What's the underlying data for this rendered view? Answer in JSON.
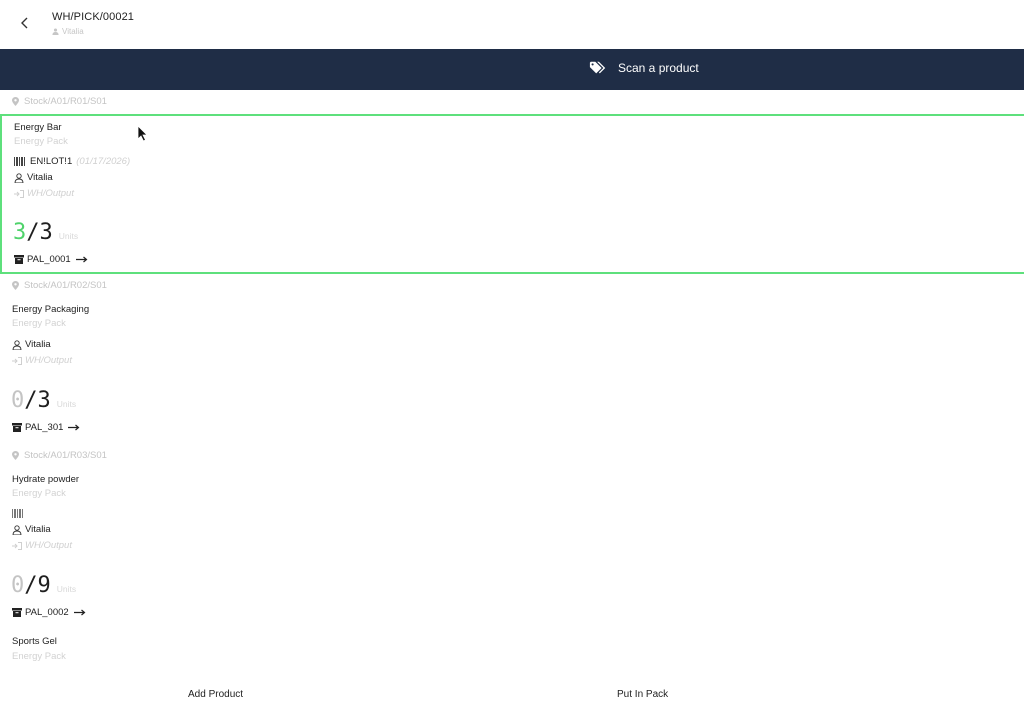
{
  "header": {
    "title": "WH/PICK/00021",
    "user": "Vitalia"
  },
  "scan": {
    "label": "Scan a product"
  },
  "lines": [
    {
      "location": "Stock/A01/R01/S01",
      "product": "Energy Bar",
      "category": "Energy Pack",
      "lot": "EN!LOT!1",
      "lot_date": "(01/17/2026)",
      "owner": "Vitalia",
      "destination": "WH/Output",
      "qty_done": "3",
      "qty_sep": "/",
      "qty_total": "3",
      "unit": "Units",
      "package": "PAL_0001",
      "active": true
    },
    {
      "location": "Stock/A01/R02/S01",
      "product": "Energy Packaging",
      "category": "Energy Pack",
      "owner": "Vitalia",
      "destination": "WH/Output",
      "qty_done": "0",
      "qty_sep": "/",
      "qty_total": "3",
      "unit": "Units",
      "package": "PAL_301",
      "active": false
    },
    {
      "location": "Stock/A01/R03/S01",
      "product": "Hydrate powder",
      "category": "Energy Pack",
      "lot": "",
      "owner": "Vitalia",
      "destination": "WH/Output",
      "qty_done": "0",
      "qty_sep": "/",
      "qty_total": "9",
      "unit": "Units",
      "package": "PAL_0002",
      "active": false
    },
    {
      "product": "Sports Gel",
      "category": "Energy Pack"
    }
  ],
  "footer": {
    "add_product": "Add Product",
    "put_in_pack": "Put In Pack"
  },
  "colors": {
    "accent_green": "#4fd36b",
    "navbar": "#1f2d46"
  }
}
